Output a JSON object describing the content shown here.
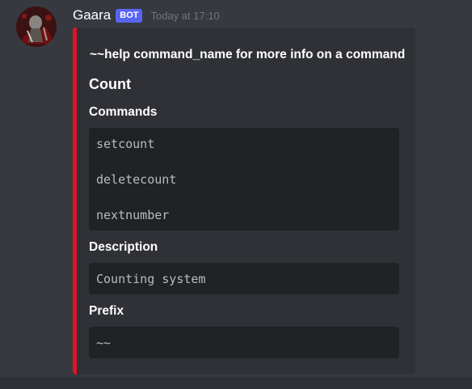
{
  "message": {
    "username": "Gaara",
    "bot_tag": "BOT",
    "timestamp": "Today at 17:10"
  },
  "embed": {
    "accent_color": "#e0112b",
    "title": "~~help command_name for more info on a command",
    "heading": "Count",
    "fields": [
      {
        "name": "Commands",
        "lines": [
          "setcount",
          "deletecount",
          "nextnumber"
        ]
      },
      {
        "name": "Description",
        "lines": [
          "Counting system"
        ]
      },
      {
        "name": "Prefix",
        "lines": [
          "~~"
        ]
      }
    ]
  },
  "colors": {
    "background": "#36393f",
    "embed_background": "#2f3136",
    "code_background": "#202225",
    "bot_tag": "#5865f2"
  }
}
